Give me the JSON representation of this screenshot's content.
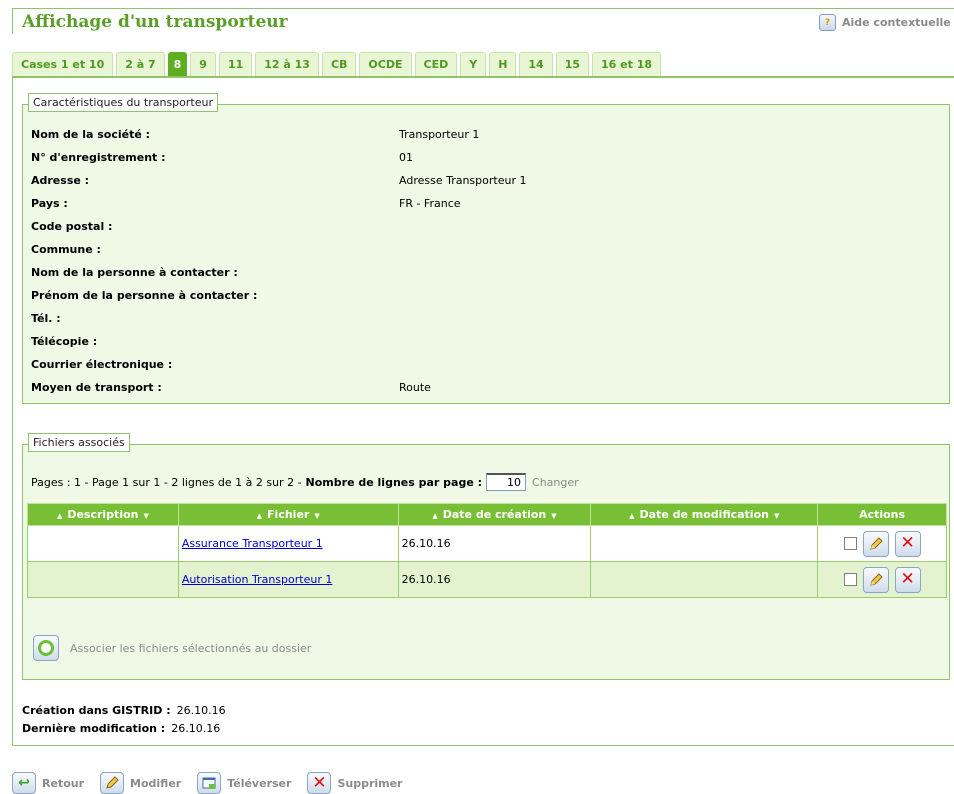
{
  "header": {
    "title": "Affichage d'un transporteur",
    "help_label": "Aide contextuelle"
  },
  "tabs": [
    {
      "label": "Cases 1 et 10",
      "active": false
    },
    {
      "label": "2 à 7",
      "active": false
    },
    {
      "label": "8",
      "active": true
    },
    {
      "label": "9",
      "active": false
    },
    {
      "label": "11",
      "active": false
    },
    {
      "label": "12 à 13",
      "active": false
    },
    {
      "label": "CB",
      "active": false
    },
    {
      "label": "OCDE",
      "active": false
    },
    {
      "label": "CED",
      "active": false
    },
    {
      "label": "Y",
      "active": false
    },
    {
      "label": "H",
      "active": false
    },
    {
      "label": "14",
      "active": false
    },
    {
      "label": "15",
      "active": false
    },
    {
      "label": "16 et 18",
      "active": false
    }
  ],
  "carrier": {
    "legend": "Caractéristiques du transporteur",
    "fields": [
      {
        "label": "Nom de la société :",
        "value": "Transporteur 1"
      },
      {
        "label": "N° d'enregistrement :",
        "value": "01"
      },
      {
        "label": "Adresse :",
        "value": "Adresse Transporteur 1"
      },
      {
        "label": "Pays :",
        "value": "FR - France"
      },
      {
        "label": "Code postal :",
        "value": ""
      },
      {
        "label": "Commune :",
        "value": ""
      },
      {
        "label": "Nom de la personne à contacter :",
        "value": ""
      },
      {
        "label": "Prénom de la personne à contacter :",
        "value": ""
      },
      {
        "label": "Tél. :",
        "value": ""
      },
      {
        "label": "Télécopie :",
        "value": ""
      },
      {
        "label": "Courrier électronique :",
        "value": ""
      },
      {
        "label": "Moyen de transport :",
        "value": "Route"
      }
    ]
  },
  "files": {
    "legend": "Fichiers associés",
    "pager_text": "Pages : 1 - Page 1 sur 1 - 2 lignes de 1 à 2 sur 2 -",
    "rows_per_page_label": "Nombre de lignes par page :",
    "rows_per_page_value": "10",
    "change_label": "Changer",
    "columns": [
      "Description",
      "Fichier",
      "Date de création",
      "Date de modification",
      "Actions"
    ],
    "rows": [
      {
        "description": "",
        "file": "Assurance Transporteur 1",
        "created": "26.10.16",
        "modified": ""
      },
      {
        "description": "",
        "file": "Autorisation Transporteur 1",
        "created": "26.10.16",
        "modified": ""
      }
    ],
    "associate_label": "Associer les fichiers sélectionnés au dossier"
  },
  "meta": {
    "created_label": "Création dans GISTRID :",
    "created_value": "26.10.16",
    "modified_label": "Dernière modification :",
    "modified_value": "26.10.16"
  },
  "footer_actions": {
    "back": "Retour",
    "edit": "Modifier",
    "upload": "Téléverser",
    "delete": "Supprimer"
  },
  "colors": {
    "accent": "#5fae21",
    "header_green": "#78bf35",
    "panel_bg": "#f0f9e6",
    "border_green": "#8fc46a",
    "delete_red": "#e01010",
    "link_blue": "#0000cc"
  }
}
